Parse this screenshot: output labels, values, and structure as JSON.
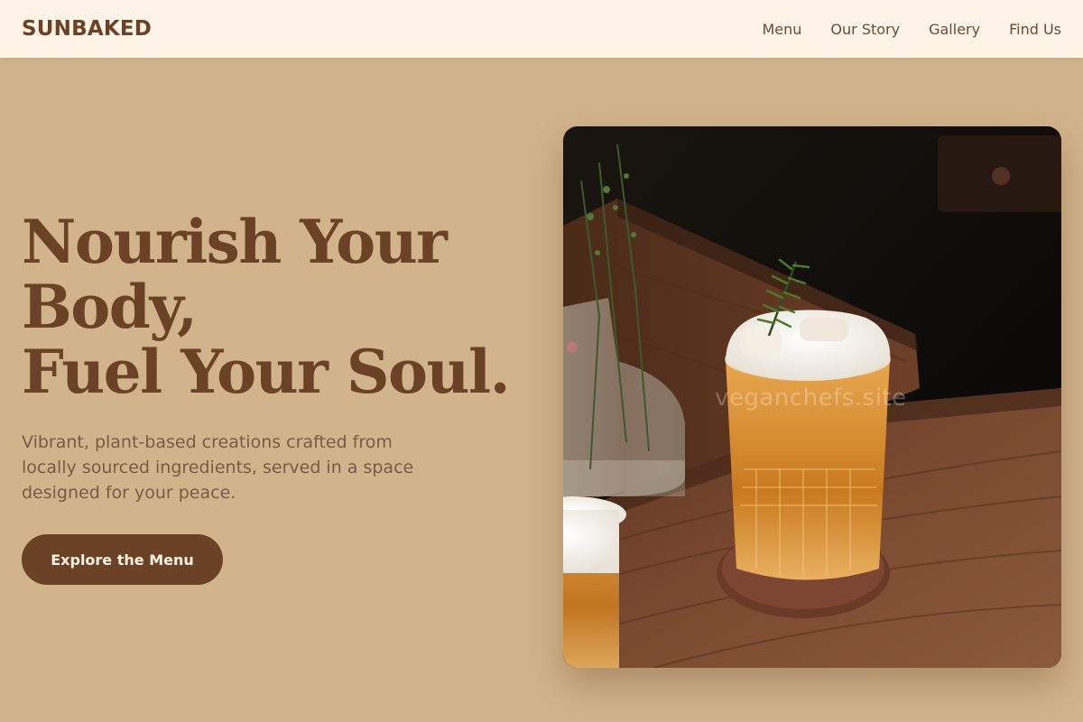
{
  "header": {
    "logo": "SUNBAKED",
    "nav": [
      {
        "label": "Menu"
      },
      {
        "label": "Our Story"
      },
      {
        "label": "Gallery"
      },
      {
        "label": "Find Us"
      }
    ]
  },
  "hero": {
    "headline_lines": [
      "Nourish Your",
      "Body,",
      "Fuel Your Soul."
    ],
    "subtitle": "Vibrant, plant-based creations crafted from locally sourced ingredients, served in a space designed for your peace.",
    "cta_label": "Explore the Menu",
    "image_watermark": "veganchefs.site"
  },
  "colors": {
    "page_bg": "#d2b48c",
    "header_bg": "#fdf3e7",
    "brand_brown": "#6b4226",
    "body_text": "#7a5a44"
  }
}
